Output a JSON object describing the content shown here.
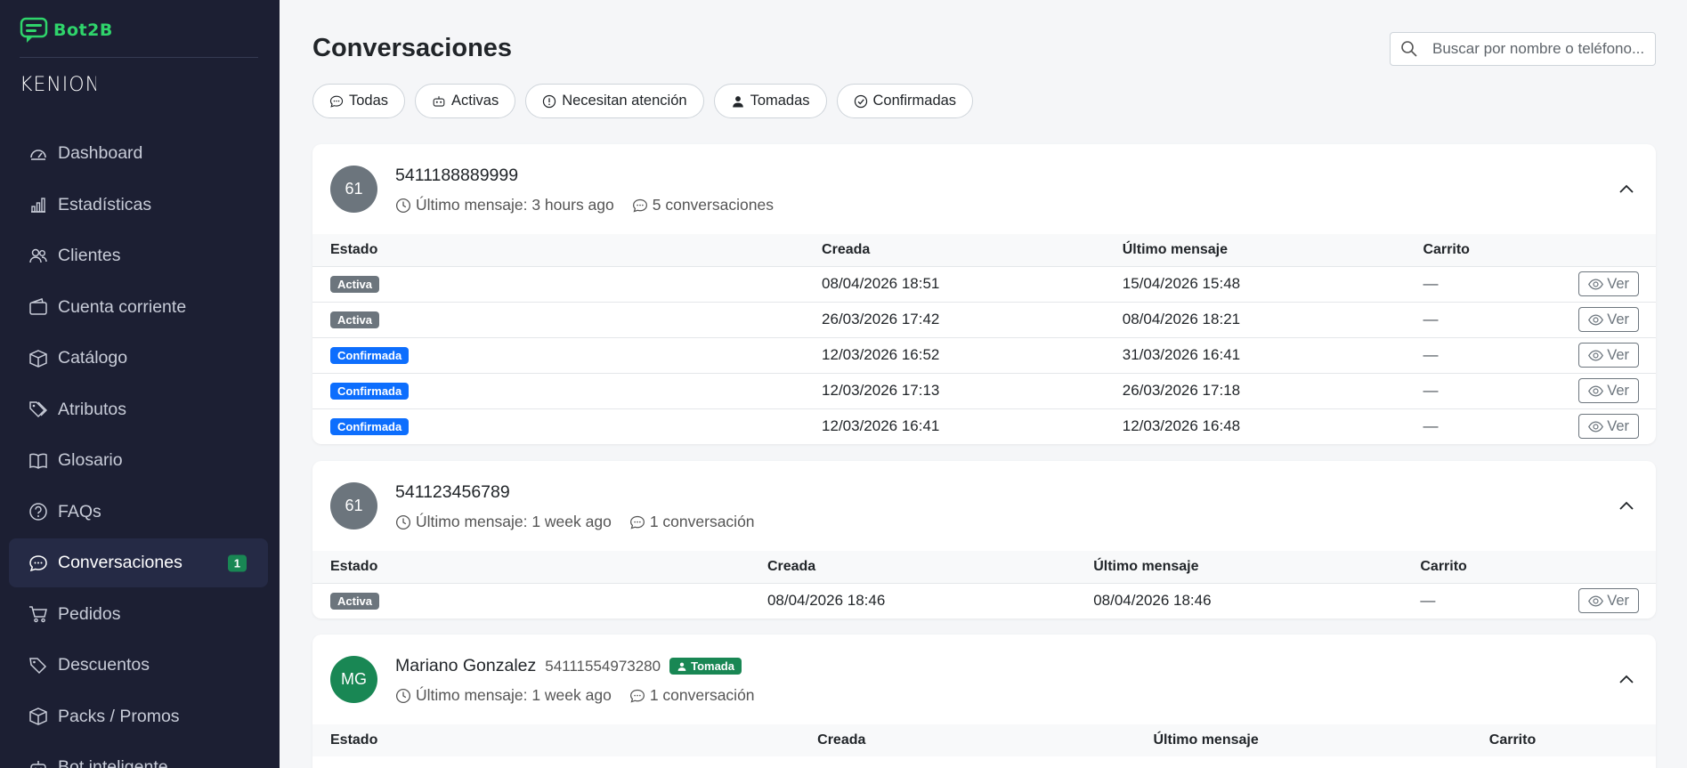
{
  "brand": {
    "name": "Bot2B",
    "org": "KENION"
  },
  "sidebar": {
    "items": [
      {
        "label": "Dashboard",
        "icon": "gauge-icon"
      },
      {
        "label": "Estadísticas",
        "icon": "bar-chart-icon"
      },
      {
        "label": "Clientes",
        "icon": "people-icon"
      },
      {
        "label": "Cuenta corriente",
        "icon": "wallet-icon"
      },
      {
        "label": "Catálogo",
        "icon": "box-icon"
      },
      {
        "label": "Atributos",
        "icon": "tags-icon"
      },
      {
        "label": "Glosario",
        "icon": "book-icon"
      },
      {
        "label": "FAQs",
        "icon": "question-circle-icon"
      },
      {
        "label": "Conversaciones",
        "icon": "chat-icon",
        "badge": "1",
        "active": true
      },
      {
        "label": "Pedidos",
        "icon": "cart-icon"
      },
      {
        "label": "Descuentos",
        "icon": "tag-icon"
      },
      {
        "label": "Packs / Promos",
        "icon": "box-icon"
      },
      {
        "label": "Bot inteligente",
        "icon": "robot-icon"
      }
    ]
  },
  "header": {
    "title": "Conversaciones",
    "search_placeholder": "Buscar por nombre o teléfono..."
  },
  "filters": [
    {
      "label": "Todas",
      "icon": "chat-icon"
    },
    {
      "label": "Activas",
      "icon": "robot-icon"
    },
    {
      "label": "Necesitan atención",
      "icon": "alert-circle-icon"
    },
    {
      "label": "Tomadas",
      "icon": "person-icon"
    },
    {
      "label": "Confirmadas",
      "icon": "check-circle-icon"
    }
  ],
  "table_headers": {
    "estado": "Estado",
    "creada": "Creada",
    "ultimo": "Último mensaje",
    "carrito": "Carrito",
    "ver": "Ver"
  },
  "colors": {
    "active": "#6c757d",
    "confirmed": "#0d6efd",
    "taken": "#198754",
    "sidebar": "#1c1f33"
  },
  "contacts": [
    {
      "avatar": "61",
      "avatar_color": "#6c757d",
      "name": "5411188889999",
      "phone": "",
      "tag": "",
      "last_message": "Último mensaje: 3 hours ago",
      "conversations": "5 conversaciones",
      "rows": [
        {
          "estado": "Activa",
          "type": "act",
          "creada": "08/04/2026 18:51",
          "ultimo": "15/04/2026 15:48",
          "carrito": "—"
        },
        {
          "estado": "Activa",
          "type": "act",
          "creada": "26/03/2026 17:42",
          "ultimo": "08/04/2026 18:21",
          "carrito": "—"
        },
        {
          "estado": "Confirmada",
          "type": "conf",
          "creada": "12/03/2026 16:52",
          "ultimo": "31/03/2026 16:41",
          "carrito": "—"
        },
        {
          "estado": "Confirmada",
          "type": "conf",
          "creada": "12/03/2026 17:13",
          "ultimo": "26/03/2026 17:18",
          "carrito": "—"
        },
        {
          "estado": "Confirmada",
          "type": "conf",
          "creada": "12/03/2026 16:41",
          "ultimo": "12/03/2026 16:48",
          "carrito": "—"
        }
      ]
    },
    {
      "avatar": "61",
      "avatar_color": "#6c757d",
      "name": "541123456789",
      "phone": "",
      "tag": "",
      "last_message": "Último mensaje: 1 week ago",
      "conversations": "1 conversación",
      "rows": [
        {
          "estado": "Activa",
          "type": "act",
          "creada": "08/04/2026 18:46",
          "ultimo": "08/04/2026 18:46",
          "carrito": "—"
        }
      ]
    },
    {
      "avatar": "MG",
      "avatar_color": "#198754",
      "name": "Mariano Gonzalez",
      "phone": "54111554973280",
      "tag": "Tomada",
      "last_message": "Último mensaje: 1 week ago",
      "conversations": "1 conversación",
      "rows": []
    }
  ]
}
